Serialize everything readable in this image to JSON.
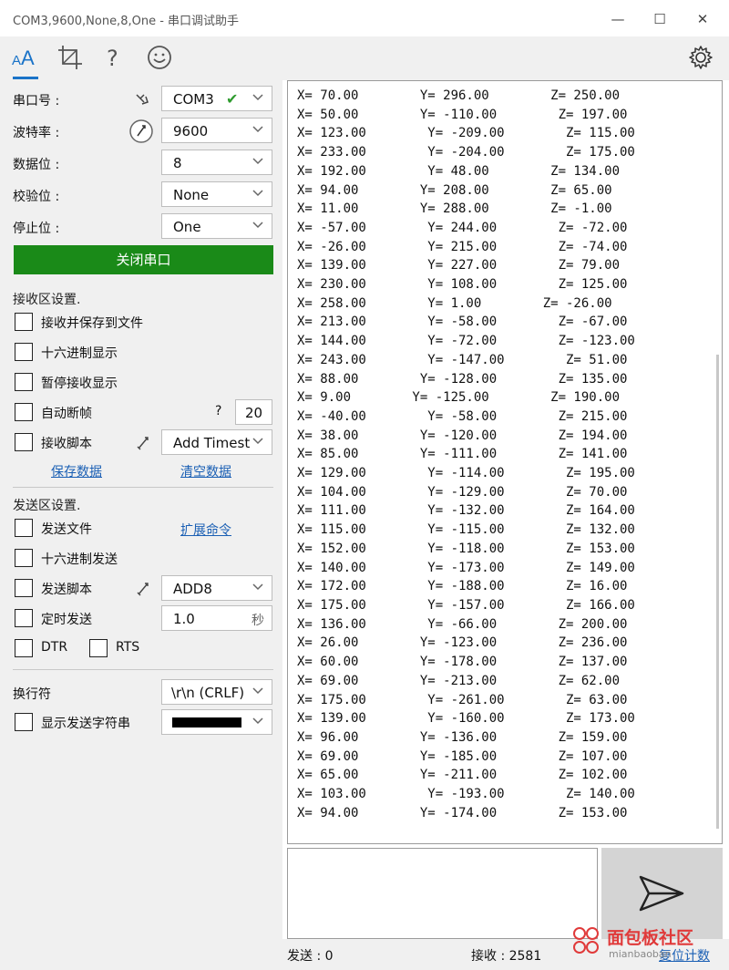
{
  "window": {
    "title": "COM3,9600,None,8,One - 串口调试助手",
    "minimize": "—",
    "maximize": "☐",
    "close": "✕"
  },
  "toolbar": {
    "items": [
      "font-icon",
      "crop-icon",
      "help-icon",
      "smiley-icon",
      "gear-icon"
    ],
    "help_glyph": "?"
  },
  "serial": {
    "port_label": "串口号 :",
    "port_value": "COM3",
    "baud_label": "波特率 :",
    "baud_value": "9600",
    "databits_label": "数据位 :",
    "databits_value": "8",
    "parity_label": "校验位 :",
    "parity_value": "None",
    "stopbits_label": "停止位 :",
    "stopbits_value": "One",
    "close_port_button": "关闭串口"
  },
  "receive_settings": {
    "title": "接收区设置.",
    "save_to_file": "接收并保存到文件",
    "hex_display": "十六进制显示",
    "pause_display": "暂停接收显示",
    "auto_frame": "自动断帧",
    "auto_frame_help": "?",
    "auto_frame_value": "20",
    "script": "接收脚本",
    "script_value": "Add Timest",
    "save_data": "保存数据",
    "clear_data": "清空数据"
  },
  "send_settings": {
    "title": "发送区设置.",
    "send_file": "发送文件",
    "extend_cmd": "扩展命令",
    "hex_send": "十六进制发送",
    "script": "发送脚本",
    "script_value": "ADD8",
    "timed_send": "定时发送",
    "timed_value": "1.0",
    "timed_unit": "秒",
    "dtr": "DTR",
    "rts": "RTS"
  },
  "line_ending": {
    "label": "换行符",
    "value": "\\r\\n (CRLF)",
    "show_send": "显示发送字符串",
    "color": "#000000"
  },
  "receive_lines": [
    "X= 70.00        Y= 296.00        Z= 250.00",
    "X= 50.00        Y= -110.00        Z= 197.00",
    "X= 123.00        Y= -209.00        Z= 115.00",
    "X= 233.00        Y= -204.00        Z= 175.00",
    "X= 192.00        Y= 48.00        Z= 134.00",
    "X= 94.00        Y= 208.00        Z= 65.00",
    "X= 11.00        Y= 288.00        Z= -1.00",
    "X= -57.00        Y= 244.00        Z= -72.00",
    "X= -26.00        Y= 215.00        Z= -74.00",
    "X= 139.00        Y= 227.00        Z= 79.00",
    "X= 230.00        Y= 108.00        Z= 125.00",
    "X= 258.00        Y= 1.00        Z= -26.00",
    "X= 213.00        Y= -58.00        Z= -67.00",
    "X= 144.00        Y= -72.00        Z= -123.00",
    "X= 243.00        Y= -147.00        Z= 51.00",
    "X= 88.00        Y= -128.00        Z= 135.00",
    "X= 9.00        Y= -125.00        Z= 190.00",
    "X= -40.00        Y= -58.00        Z= 215.00",
    "X= 38.00        Y= -120.00        Z= 194.00",
    "X= 85.00        Y= -111.00        Z= 141.00",
    "X= 129.00        Y= -114.00        Z= 195.00",
    "X= 104.00        Y= -129.00        Z= 70.00",
    "X= 111.00        Y= -132.00        Z= 164.00",
    "X= 115.00        Y= -115.00        Z= 132.00",
    "X= 152.00        Y= -118.00        Z= 153.00",
    "X= 140.00        Y= -173.00        Z= 149.00",
    "X= 172.00        Y= -188.00        Z= 16.00",
    "X= 175.00        Y= -157.00        Z= 166.00",
    "X= 136.00        Y= -66.00        Z= 200.00",
    "X= 26.00        Y= -123.00        Z= 236.00",
    "X= 60.00        Y= -178.00        Z= 137.00",
    "X= 69.00        Y= -213.00        Z= 62.00",
    "X= 175.00        Y= -261.00        Z= 63.00",
    "X= 139.00        Y= -160.00        Z= 173.00",
    "X= 96.00        Y= -136.00        Z= 159.00",
    "X= 69.00        Y= -185.00        Z= 107.00",
    "X= 65.00        Y= -211.00        Z= 102.00",
    "X= 103.00        Y= -193.00        Z= 140.00",
    "X= 94.00        Y= -174.00        Z= 153.00"
  ],
  "status": {
    "sent": "发送 : 0",
    "received": "接收 : 2581",
    "reset_count": "复位计数"
  },
  "watermark": {
    "text": "面包板社区",
    "sub": "mianbaoban"
  },
  "colors": {
    "accent": "#1a73c8",
    "open_port_button": "#1a8a18",
    "link": "#1a5fb4",
    "check_ok": "#2e9b2e"
  }
}
